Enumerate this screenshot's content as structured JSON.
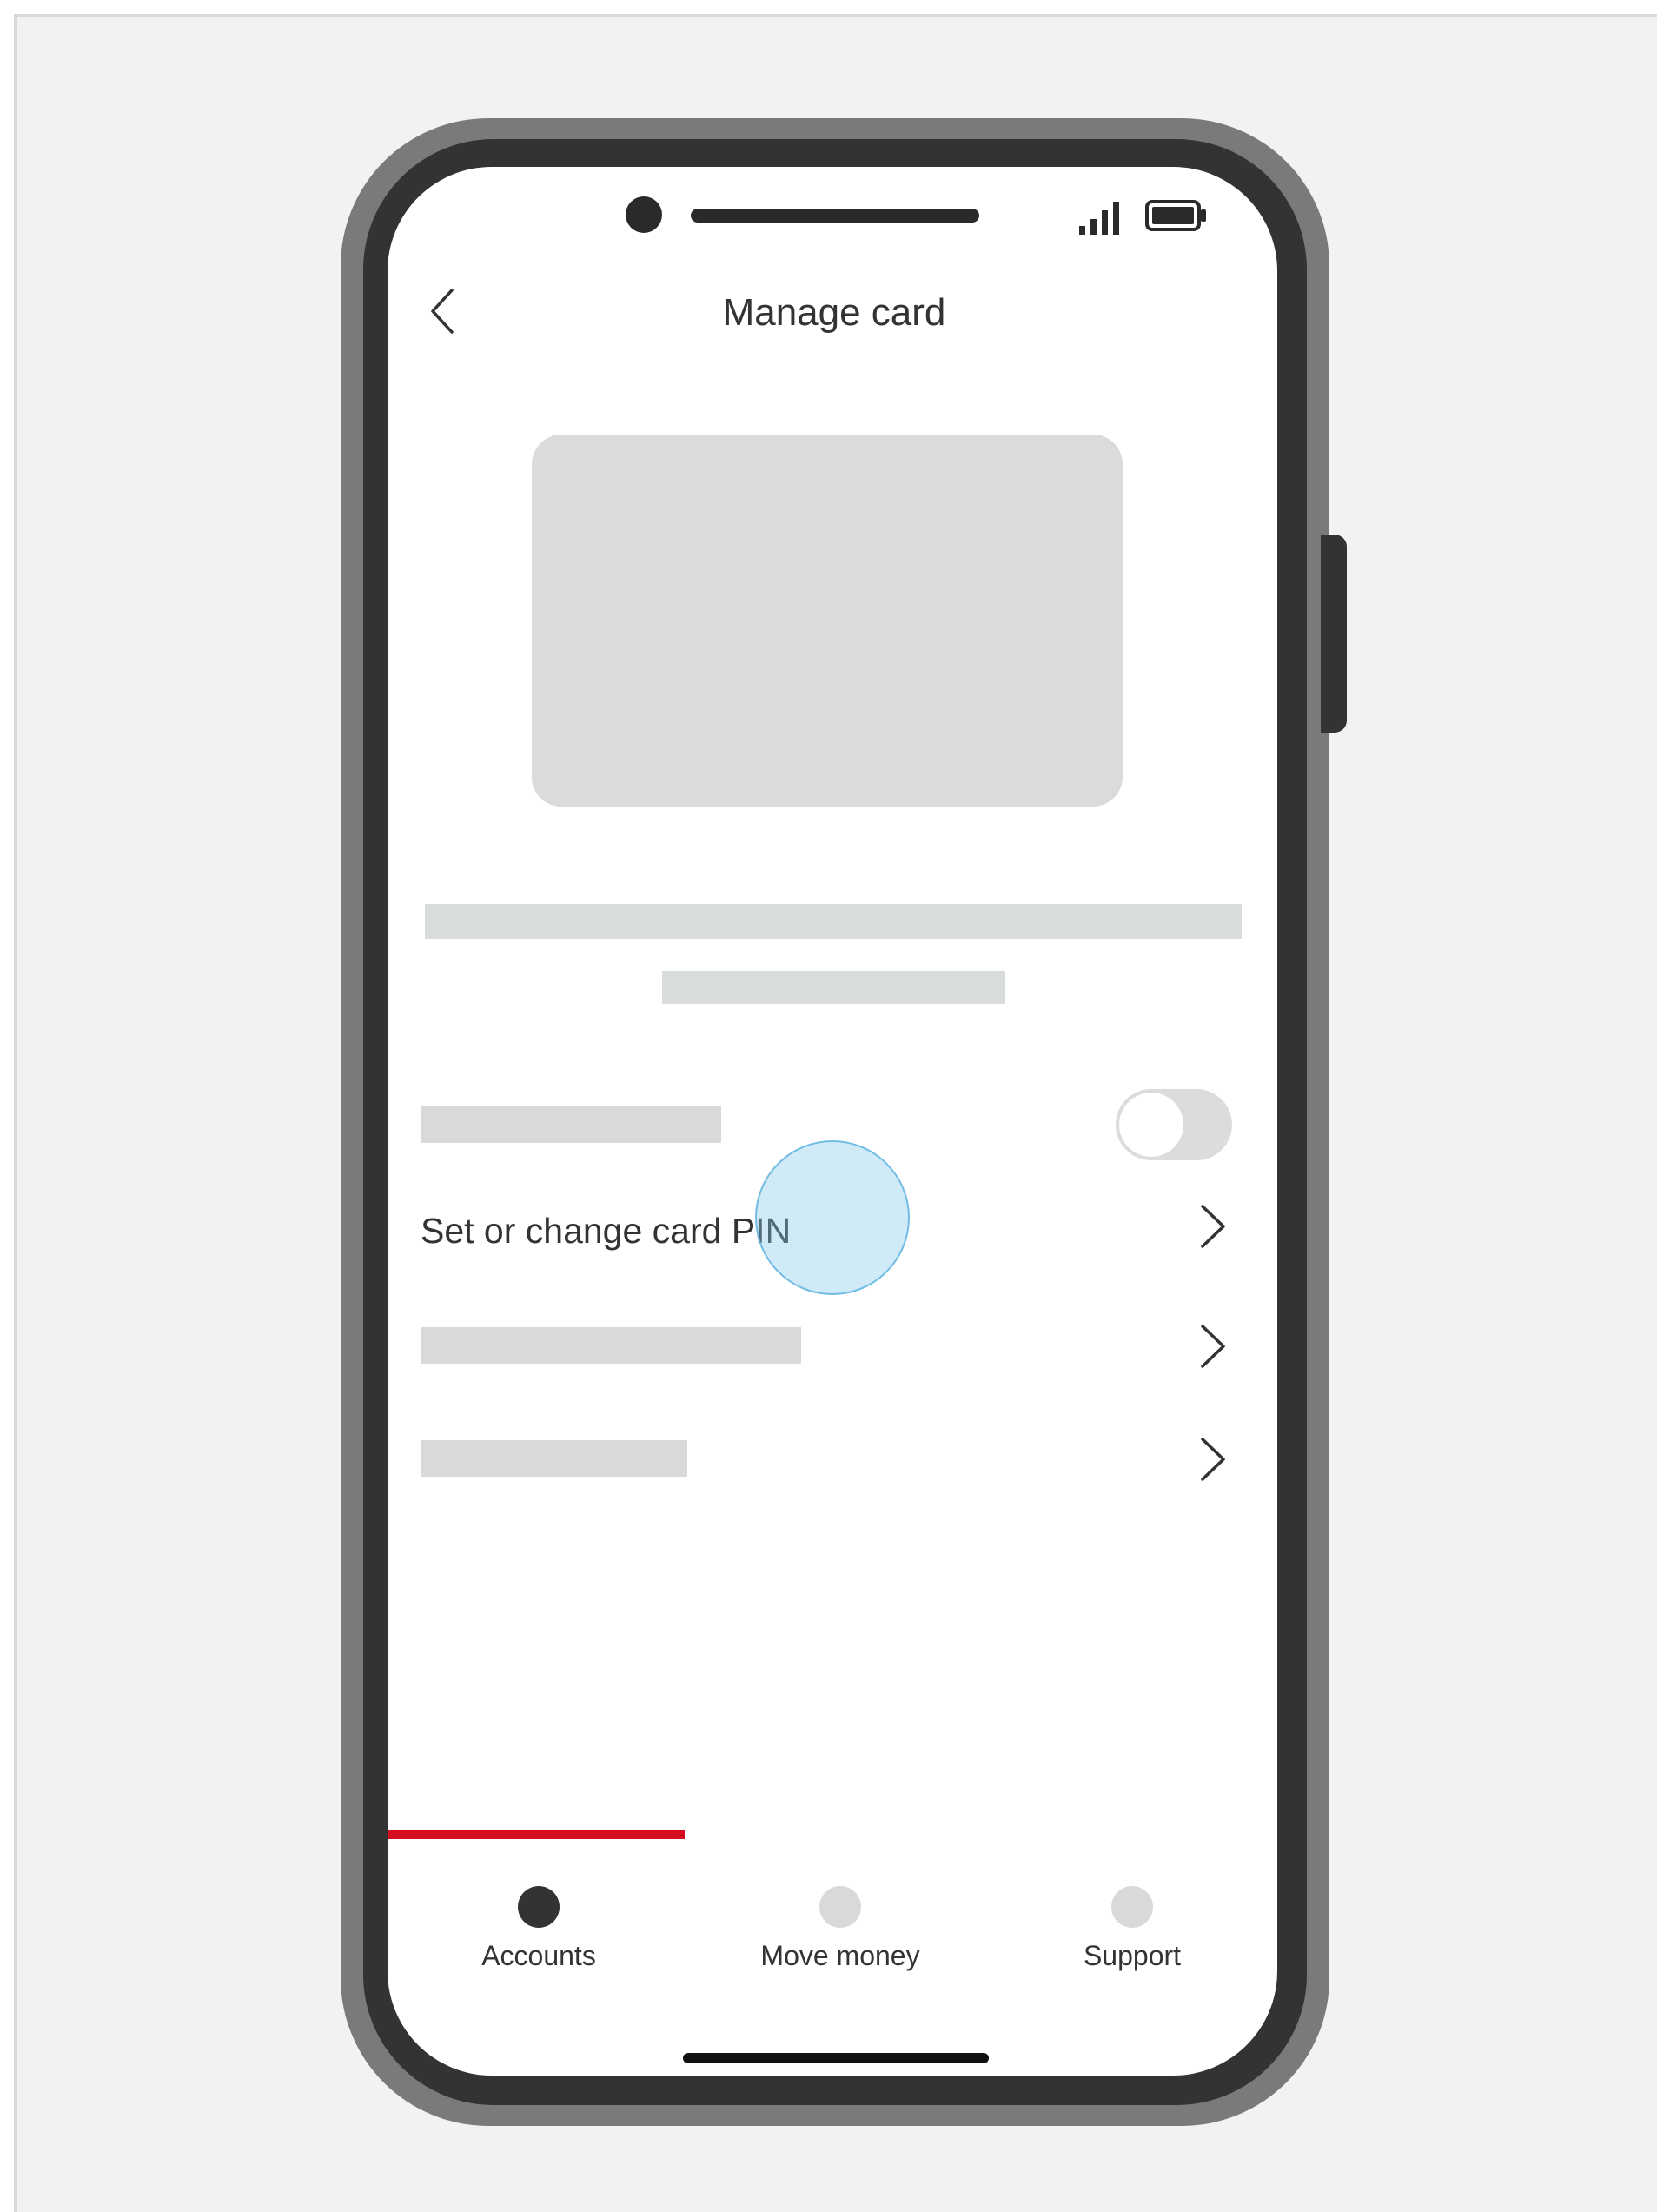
{
  "header": {
    "title": "Manage card"
  },
  "settings": {
    "pin_row_label": "Set or change card PIN",
    "card_toggle_on": false
  },
  "bottom_nav": {
    "items": [
      {
        "label": "Accounts",
        "active": true
      },
      {
        "label": "Move money",
        "active": false
      },
      {
        "label": "Support",
        "active": false
      }
    ]
  },
  "colors": {
    "accent": "#d40e1e",
    "active_nav_dot": "#333333",
    "inactive_nav_dot": "#d9d9d9",
    "tap_indicator": "#87c8eb",
    "placeholder": "#d9dcdc"
  },
  "icons": {
    "back": "chevron-left-icon",
    "row_arrow": "chevron-right-icon",
    "signal": "signal-icon",
    "battery": "battery-icon"
  }
}
